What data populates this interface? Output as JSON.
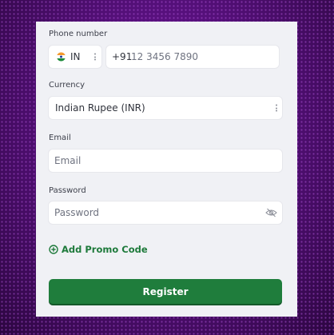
{
  "form": {
    "phone": {
      "label": "Phone number",
      "country_code": "IN",
      "country_icon": "india-flag-icon",
      "dial_prefix": "+91",
      "placeholder": "12 3456 7890"
    },
    "currency": {
      "label": "Currency",
      "selected": "Indian Rupee (INR)"
    },
    "email": {
      "label": "Email",
      "placeholder": "Email"
    },
    "password": {
      "label": "Password",
      "placeholder": "Password",
      "toggle_icon": "eye-slash-icon"
    },
    "promo": {
      "icon": "plus-circle-icon",
      "label": "Add Promo Code"
    },
    "register_label": "Register"
  },
  "colors": {
    "background": "#55107a",
    "card": "#f0f1f5",
    "accent_green": "#1f7d3c",
    "promo_text": "#1e7a3b"
  }
}
